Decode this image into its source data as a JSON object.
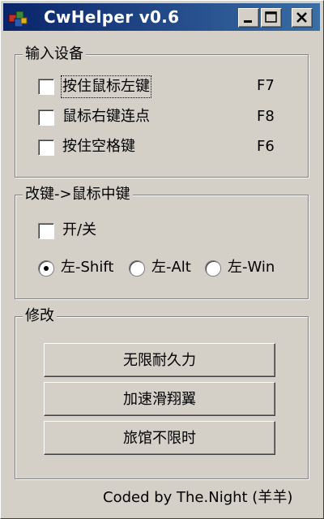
{
  "window": {
    "title": "CwHelper v0.6",
    "controls": {
      "minimize": "minimize-icon",
      "maximize": "maximize-icon",
      "close": "close-icon"
    }
  },
  "input_group": {
    "title": "输入设备",
    "items": [
      {
        "label": "按住鼠标左键",
        "key": "F7",
        "checked": false
      },
      {
        "label": "鼠标右键连点",
        "key": "F8",
        "checked": false
      },
      {
        "label": "按住空格键",
        "key": "F6",
        "checked": false
      }
    ]
  },
  "remap_group": {
    "title": "改键->鼠标中键",
    "toggle_label": "开/关",
    "toggle_checked": false,
    "options": [
      "左-Shift",
      "左-Alt",
      "左-Win"
    ],
    "selected": "左-Shift"
  },
  "modify_group": {
    "title": "修改",
    "buttons": [
      "无限耐久力",
      "加速滑翔翼",
      "旅馆不限时"
    ]
  },
  "footer": "Coded by The.Night (羊羊)"
}
